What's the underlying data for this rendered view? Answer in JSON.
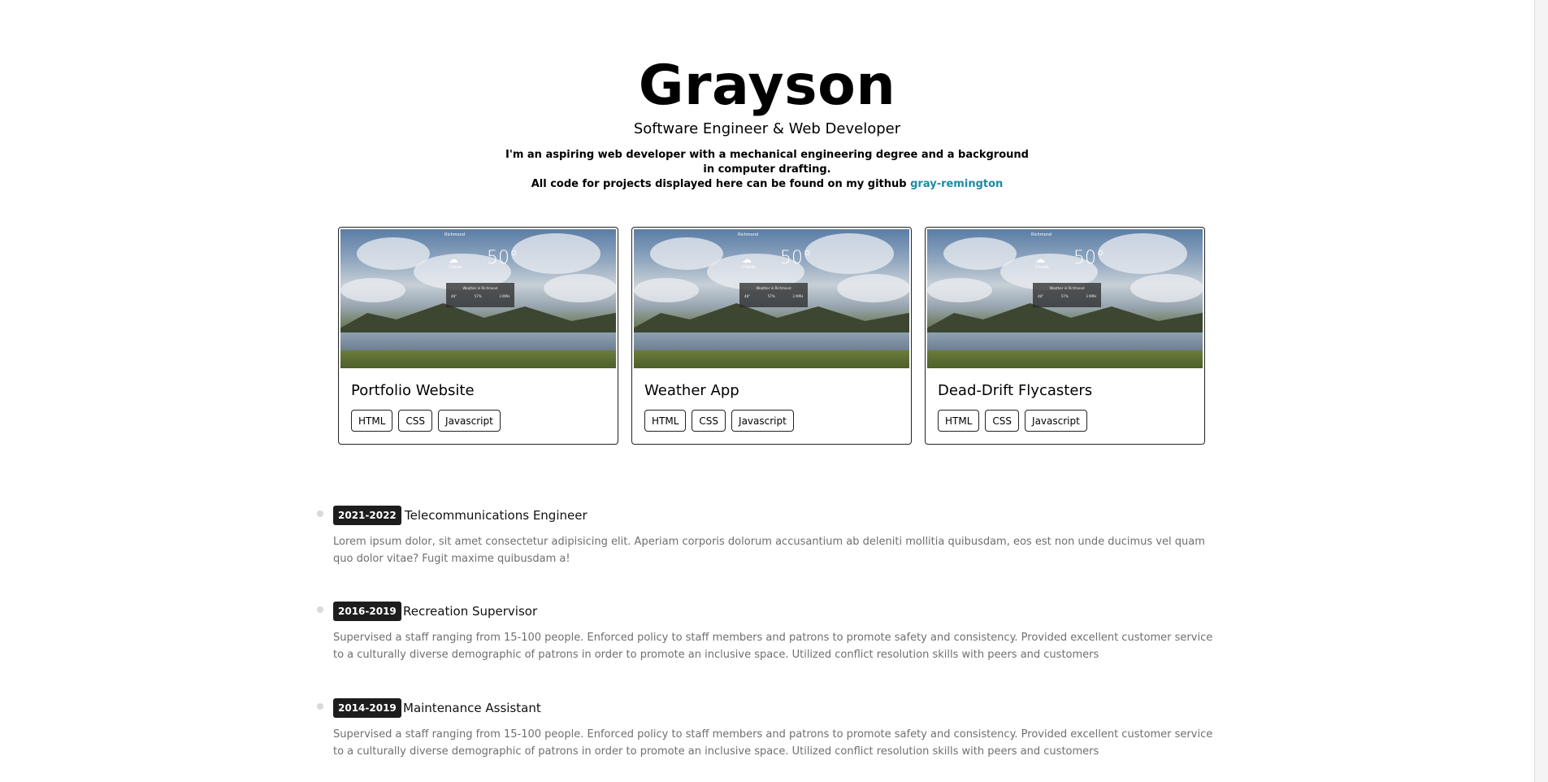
{
  "hero": {
    "name": "Grayson",
    "subtitle": "Software Engineer & Web Developer",
    "bio_line1": "I'm an aspiring web developer with a mechanical engineering degree and a background",
    "bio_line2": "in computer drafting.",
    "bio_line3_prefix": "All code for projects displayed here can be found on my github ",
    "github_link": "gray-remington",
    "link_color": "#1b8ba3"
  },
  "projects": [
    {
      "title": "Portfolio Website",
      "tags": [
        "HTML",
        "CSS",
        "Javascript"
      ],
      "thumb": {
        "city": "Richmond",
        "condition": "Clouds",
        "temp": "50°",
        "panel_title": "Weather in Richmond",
        "vals": [
          "48°",
          "57%",
          "3 MPH"
        ]
      }
    },
    {
      "title": "Weather App",
      "tags": [
        "HTML",
        "CSS",
        "Javascript"
      ],
      "thumb": {
        "city": "Richmond",
        "condition": "Clouds",
        "temp": "50°",
        "panel_title": "Weather in Richmond",
        "vals": [
          "48°",
          "57%",
          "3 MPH"
        ]
      }
    },
    {
      "title": "Dead-Drift Flycasters",
      "tags": [
        "HTML",
        "CSS",
        "Javascript"
      ],
      "thumb": {
        "city": "Richmond",
        "condition": "Clouds",
        "temp": "50°",
        "panel_title": "Weather in Richmond",
        "vals": [
          "48°",
          "57%",
          "3 MPH"
        ]
      }
    }
  ],
  "timeline": [
    {
      "years": "2021-2022",
      "role": "Telecommunications Engineer",
      "description": "Lorem ipsum dolor, sit amet consectetur adipisicing elit. Aperiam corporis dolorum accusantium ab deleniti mollitia quibusdam, eos est non unde ducimus vel quam quo dolor vitae? Fugit maxime quibusdam a!"
    },
    {
      "years": "2016-2019",
      "role": "Recreation Supervisor",
      "description": "Supervised a staff ranging from 15-100 people. Enforced policy to staff members and patrons to promote safety and consistency. Provided excellent customer service to a culturally diverse demographic of patrons in order to promote an inclusive space. Utilized conflict resolution skills with peers and customers"
    },
    {
      "years": "2014-2019",
      "role": "Maintenance Assistant",
      "description": "Supervised a staff ranging from 15-100 people. Enforced policy to staff members and patrons to promote safety and consistency. Provided excellent customer service to a culturally diverse demographic of patrons in order to promote an inclusive space. Utilized conflict resolution skills with peers and customers"
    }
  ]
}
